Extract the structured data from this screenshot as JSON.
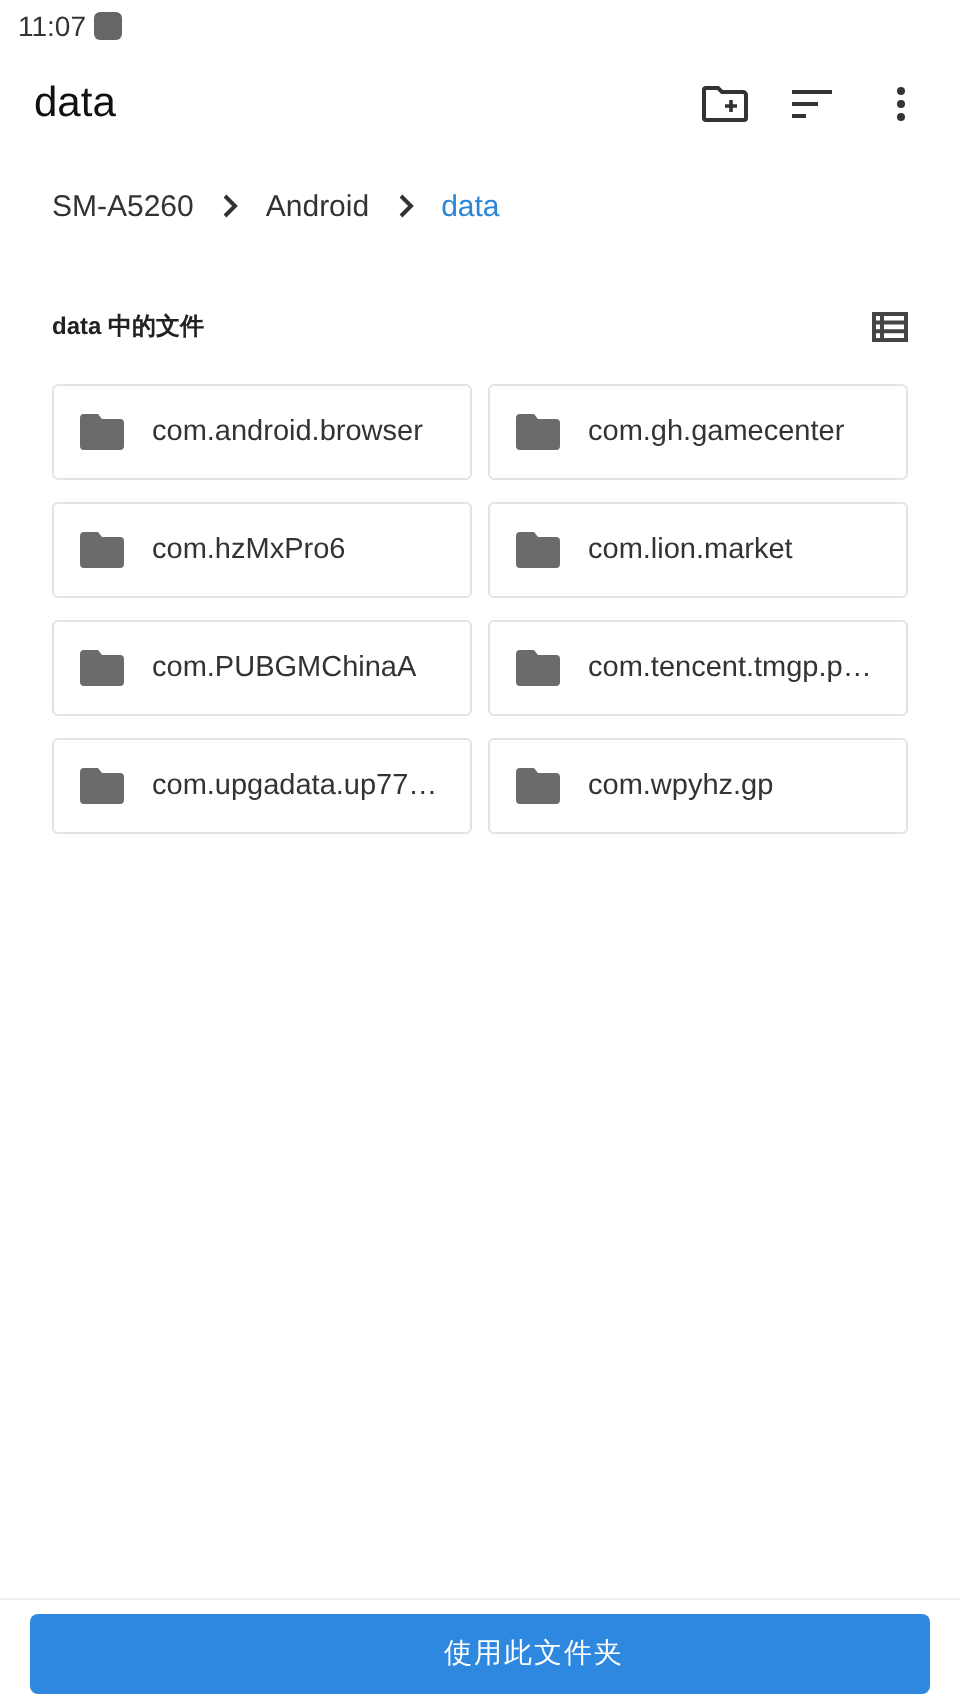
{
  "status_bar": {
    "time": "11:07"
  },
  "app_bar": {
    "title": "data"
  },
  "breadcrumbs": [
    {
      "label": "SM-A5260",
      "selected": false
    },
    {
      "label": "Android",
      "selected": false
    },
    {
      "label": "data",
      "selected": true
    }
  ],
  "section": {
    "title": "data 中的文件"
  },
  "folders": [
    {
      "name": "com.android.browser"
    },
    {
      "name": "com.gh.gamecenter"
    },
    {
      "name": "com.hzMxPro6"
    },
    {
      "name": "com.lion.market"
    },
    {
      "name": "com.PUBGMChinaA"
    },
    {
      "name": "com.tencent.tmgp.p…"
    },
    {
      "name": "com.upgadata.up77…"
    },
    {
      "name": "com.wpyhz.gp"
    }
  ],
  "action_button": {
    "label": "使用此文件夹"
  }
}
